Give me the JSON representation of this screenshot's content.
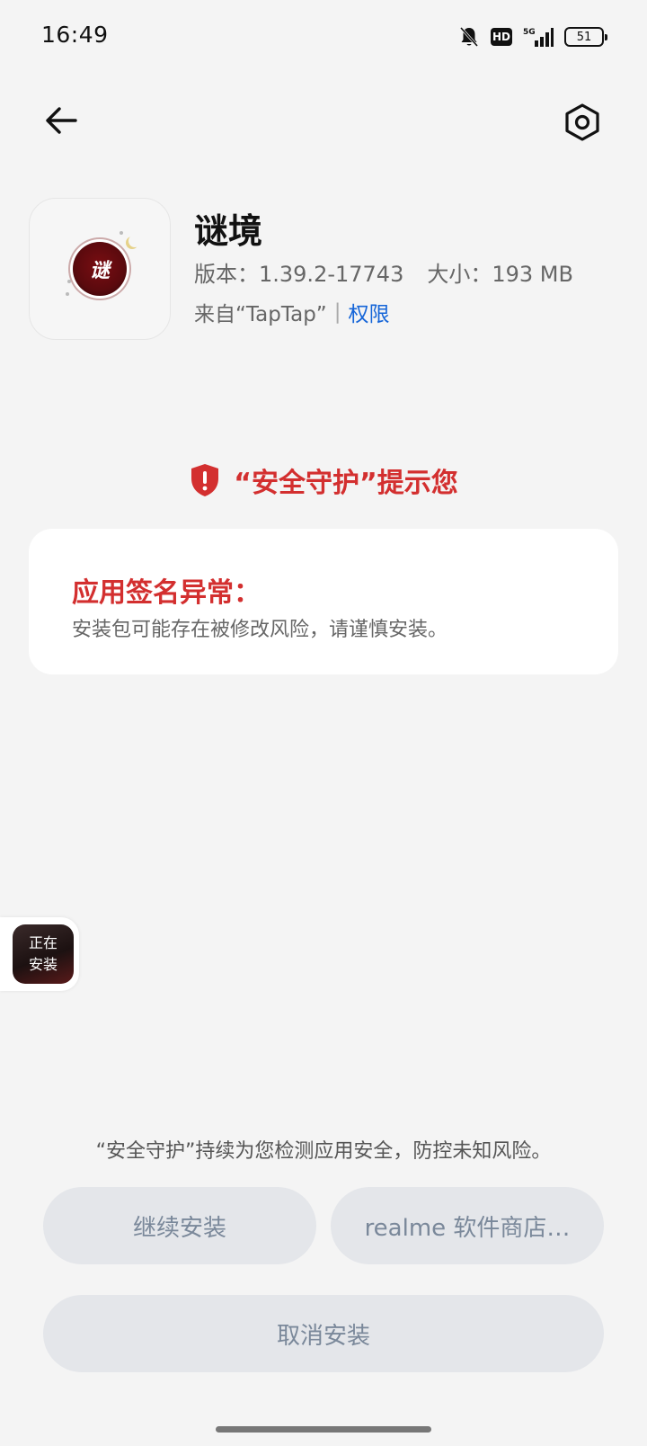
{
  "status_bar": {
    "time": "16:49",
    "hd_label": "HD",
    "network_label": "5G",
    "battery_level": "51"
  },
  "app": {
    "name": "谜境",
    "version": "版本：1.39.2-17743",
    "size": "大小：193 MB",
    "source": "来自“TapTap”",
    "separator": "|",
    "permissions_link": "权限",
    "logo_text": "谜"
  },
  "security": {
    "header": "“安全守护”提示您",
    "card_title": "应用签名异常：",
    "card_description": "安装包可能存在被修改风险，请谨慎安装。"
  },
  "floating": {
    "line1": "正在",
    "line2": "安装"
  },
  "footer": {
    "note": "“安全守护”持续为您检测应用安全，防控未知风险。",
    "continue_button": "继续安装",
    "store_button": "realme 软件商店…",
    "cancel_button": "取消安装"
  },
  "colors": {
    "warning_red": "#d32f2f",
    "link_blue": "#1565d8",
    "button_bg": "#e4e6ea",
    "button_text": "#7a889a",
    "page_bg": "#f4f4f4"
  },
  "icons": {
    "back": "back-arrow-icon",
    "settings": "settings-hexagon-icon",
    "shield": "shield-alert-icon",
    "bell": "bell-off-icon",
    "signal": "signal-icon",
    "battery": "battery-icon"
  }
}
